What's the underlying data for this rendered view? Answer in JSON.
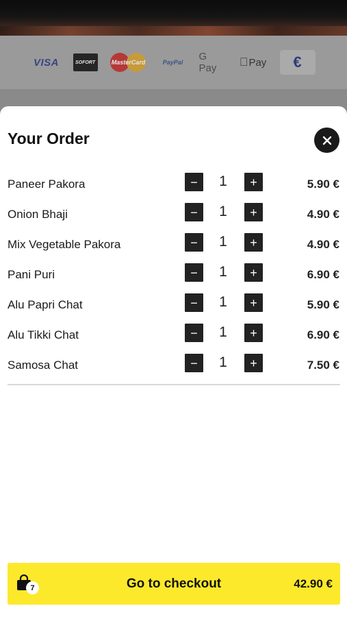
{
  "payment_methods": [
    {
      "name": "VISA",
      "icon": "visa-logo"
    },
    {
      "name": "SOFORT",
      "icon": "sofort-logo"
    },
    {
      "name": "MasterCard",
      "icon": "mastercard-logo"
    },
    {
      "name": "PayPal",
      "icon": "paypal-logo"
    },
    {
      "name": "G Pay",
      "icon": "google-pay-logo"
    },
    {
      "name": "Pay",
      "icon": "apple-pay-logo"
    },
    {
      "name": "€",
      "icon": "euro-icon"
    }
  ],
  "order": {
    "title": "Your Order",
    "items": [
      {
        "name": "Paneer Pakora",
        "qty": "1",
        "price": "5.90 €"
      },
      {
        "name": "Onion Bhaji",
        "qty": "1",
        "price": "4.90 €"
      },
      {
        "name": "Mix Vegetable Pakora",
        "qty": "1",
        "price": "4.90 €"
      },
      {
        "name": "Pani Puri",
        "qty": "1",
        "price": "6.90 €"
      },
      {
        "name": "Alu Papri Chat",
        "qty": "1",
        "price": "5.90 €"
      },
      {
        "name": "Alu Tikki Chat",
        "qty": "1",
        "price": "6.90 €"
      },
      {
        "name": "Samosa Chat",
        "qty": "1",
        "price": "7.50 €"
      }
    ]
  },
  "checkout": {
    "label": "Go to checkout",
    "total": "42.90 €",
    "item_count": "7"
  },
  "colors": {
    "accent": "#fde92b",
    "button_dark": "#222222"
  }
}
